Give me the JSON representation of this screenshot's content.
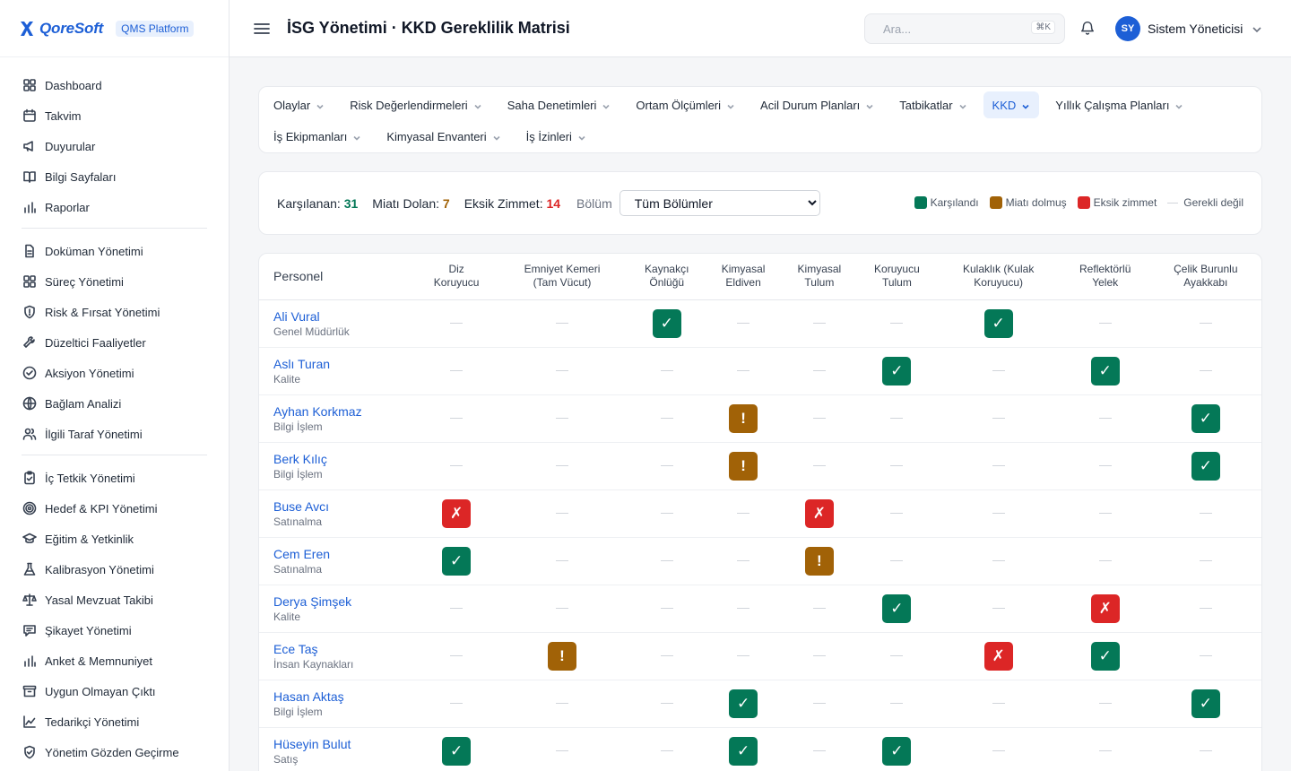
{
  "brand": {
    "logo_text": "QoreSoft",
    "platform": "QMS Platform"
  },
  "sidebar": {
    "groups": [
      [
        {
          "label": "Dashboard",
          "icon": "grid-icon"
        },
        {
          "label": "Takvim",
          "icon": "calendar-icon"
        },
        {
          "label": "Duyurular",
          "icon": "megaphone-icon"
        },
        {
          "label": "Bilgi Sayfaları",
          "icon": "book-icon"
        },
        {
          "label": "Raporlar",
          "icon": "bar-chart-icon"
        }
      ],
      [
        {
          "label": "Doküman Yönetimi",
          "icon": "document-icon"
        },
        {
          "label": "Süreç Yönetimi",
          "icon": "grid-icon"
        },
        {
          "label": "Risk & Fırsat Yönetimi",
          "icon": "shield-icon"
        },
        {
          "label": "Düzeltici Faaliyetler",
          "icon": "wrench-icon"
        },
        {
          "label": "Aksiyon Yönetimi",
          "icon": "check-circle-icon"
        },
        {
          "label": "Bağlam Analizi",
          "icon": "globe-icon"
        },
        {
          "label": "İlgili Taraf Yönetimi",
          "icon": "users-icon"
        }
      ],
      [
        {
          "label": "İç Tetkik Yönetimi",
          "icon": "clipboard-icon"
        },
        {
          "label": "Hedef & KPI Yönetimi",
          "icon": "target-icon"
        },
        {
          "label": "Eğitim & Yetkinlik",
          "icon": "graduation-cap-icon"
        },
        {
          "label": "Kalibrasyon Yönetimi",
          "icon": "flask-icon"
        },
        {
          "label": "Yasal Mevzuat Takibi",
          "icon": "scale-icon"
        },
        {
          "label": "Şikayet Yönetimi",
          "icon": "message-icon"
        },
        {
          "label": "Anket & Memnuniyet",
          "icon": "bar-chart-icon"
        },
        {
          "label": "Uygun Olmayan Çıktı",
          "icon": "archive-icon"
        },
        {
          "label": "Tedarikçi Yönetimi",
          "icon": "line-chart-icon"
        },
        {
          "label": "Yönetim Gözden Geçirme",
          "icon": "shield-check-icon"
        }
      ]
    ]
  },
  "header": {
    "title": "İSG Yönetimi · KKD Gereklilik Matrisi",
    "search_placeholder": "Ara...",
    "search_shortcut": "⌘K",
    "user_initials": "SY",
    "user_name": "Sistem Yöneticisi"
  },
  "tabs": {
    "row1": [
      "Olaylar",
      "Risk Değerlendirmeleri",
      "Saha Denetimleri",
      "Ortam Ölçümleri",
      "Acil Durum Planları",
      "Tatbikatlar",
      "KKD",
      "Yıllık Çalışma Planları"
    ],
    "row2": [
      "İş Ekipmanları",
      "Kimyasal Envanteri",
      "İş İzinleri"
    ],
    "active": "KKD"
  },
  "filters": {
    "met_label": "Karşılanan:",
    "met_value": "31",
    "expired_label": "Miatı Dolan:",
    "expired_value": "7",
    "missing_label": "Eksik Zimmet:",
    "missing_value": "14",
    "department_label": "Bölüm",
    "department_selected": "Tüm Bölümler"
  },
  "legend": {
    "ok": "Karşılandı",
    "exp": "Miatı dolmuş",
    "miss": "Eksik zimmet",
    "na": "Gerekli değil"
  },
  "colors": {
    "ok": "#047857",
    "exp": "#a16207",
    "miss": "#dc2626",
    "accent": "#1d5fd6"
  },
  "symbols": {
    "ok": "✓",
    "exp": "!",
    "miss": "✗"
  },
  "matrix": {
    "person_header": "Personel",
    "columns": [
      [
        "Diz",
        "Koruyucu"
      ],
      [
        "Emniyet Kemeri",
        "(Tam Vücut)"
      ],
      [
        "Kaynakçı",
        "Önlüğü"
      ],
      [
        "Kimyasal",
        "Eldiven"
      ],
      [
        "Kimyasal",
        "Tulum"
      ],
      [
        "Koruyucu",
        "Tulum"
      ],
      [
        "Kulaklık (Kulak",
        "Koruyucu)"
      ],
      [
        "Reflektörlü",
        "Yelek"
      ],
      [
        "Çelik Burunlu",
        "Ayakkabı"
      ]
    ],
    "rows": [
      {
        "name": "Ali Vural",
        "dept": "Genel Müdürlük",
        "cells": [
          "na",
          "na",
          "ok",
          "na",
          "na",
          "na",
          "ok",
          "na",
          "na"
        ]
      },
      {
        "name": "Aslı Turan",
        "dept": "Kalite",
        "cells": [
          "na",
          "na",
          "na",
          "na",
          "na",
          "ok",
          "na",
          "ok",
          "na"
        ]
      },
      {
        "name": "Ayhan Korkmaz",
        "dept": "Bilgi İşlem",
        "cells": [
          "na",
          "na",
          "na",
          "exp",
          "na",
          "na",
          "na",
          "na",
          "ok"
        ]
      },
      {
        "name": "Berk Kılıç",
        "dept": "Bilgi İşlem",
        "cells": [
          "na",
          "na",
          "na",
          "exp",
          "na",
          "na",
          "na",
          "na",
          "ok"
        ]
      },
      {
        "name": "Buse Avcı",
        "dept": "Satınalma",
        "cells": [
          "miss",
          "na",
          "na",
          "na",
          "miss",
          "na",
          "na",
          "na",
          "na"
        ]
      },
      {
        "name": "Cem Eren",
        "dept": "Satınalma",
        "cells": [
          "ok",
          "na",
          "na",
          "na",
          "exp",
          "na",
          "na",
          "na",
          "na"
        ]
      },
      {
        "name": "Derya Şimşek",
        "dept": "Kalite",
        "cells": [
          "na",
          "na",
          "na",
          "na",
          "na",
          "ok",
          "na",
          "miss",
          "na"
        ]
      },
      {
        "name": "Ece Taş",
        "dept": "İnsan Kaynakları",
        "cells": [
          "na",
          "exp",
          "na",
          "na",
          "na",
          "na",
          "miss",
          "ok",
          "na"
        ]
      },
      {
        "name": "Hasan Aktaş",
        "dept": "Bilgi İşlem",
        "cells": [
          "na",
          "na",
          "na",
          "ok",
          "na",
          "na",
          "na",
          "na",
          "ok"
        ]
      },
      {
        "name": "Hüseyin Bulut",
        "dept": "Satış",
        "cells": [
          "ok",
          "na",
          "na",
          "ok",
          "na",
          "ok",
          "na",
          "na",
          "na"
        ]
      }
    ]
  }
}
